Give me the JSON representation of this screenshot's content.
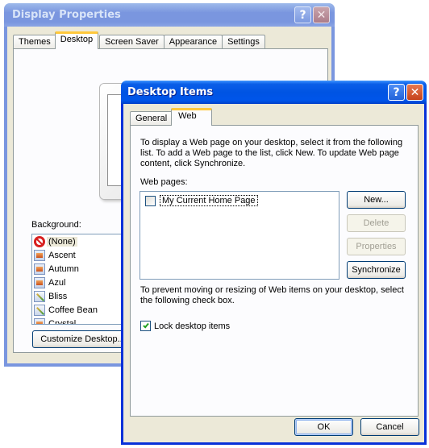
{
  "display_properties": {
    "title": "Display Properties",
    "tabs": [
      {
        "label": "Themes",
        "active": false
      },
      {
        "label": "Desktop",
        "active": true
      },
      {
        "label": "Screen Saver",
        "active": false
      },
      {
        "label": "Appearance",
        "active": false
      },
      {
        "label": "Settings",
        "active": false
      }
    ],
    "background_label": "Background:",
    "background_items": [
      {
        "label": "(None)",
        "icon": "none-icon",
        "selected": true
      },
      {
        "label": "Ascent",
        "icon": "image-file-icon",
        "selected": false
      },
      {
        "label": "Autumn",
        "icon": "image-file-icon",
        "selected": false
      },
      {
        "label": "Azul",
        "icon": "image-file-icon",
        "selected": false
      },
      {
        "label": "Bliss",
        "icon": "bitmap-file-icon",
        "selected": false
      },
      {
        "label": "Coffee Bean",
        "icon": "bitmap-file-icon",
        "selected": false
      },
      {
        "label": "Crystal",
        "icon": "image-file-icon",
        "selected": false
      }
    ],
    "customize_button": "Customize Desktop...",
    "help_glyph": "?",
    "close_glyph": "✕"
  },
  "desktop_items": {
    "title": "Desktop Items",
    "tabs": [
      {
        "label": "General",
        "active": false
      },
      {
        "label": "Web",
        "active": true
      }
    ],
    "intro_text": "To display a Web page on your desktop, select it from the following list. To add a Web page to the list, click New.  To update Web page content, click Synchronize.",
    "web_pages_label": "Web pages:",
    "web_pages": [
      {
        "label": "My Current Home Page",
        "checked": false
      }
    ],
    "buttons": {
      "new": "New...",
      "delete": "Delete",
      "properties": "Properties",
      "synchronize": "Synchronize"
    },
    "lock_text": "To prevent moving or resizing of Web items on your desktop, select the following check box.",
    "lock_checkbox": {
      "label": "Lock desktop items",
      "checked": true
    },
    "ok": "OK",
    "cancel": "Cancel",
    "help_glyph": "?",
    "close_glyph": "✕"
  }
}
